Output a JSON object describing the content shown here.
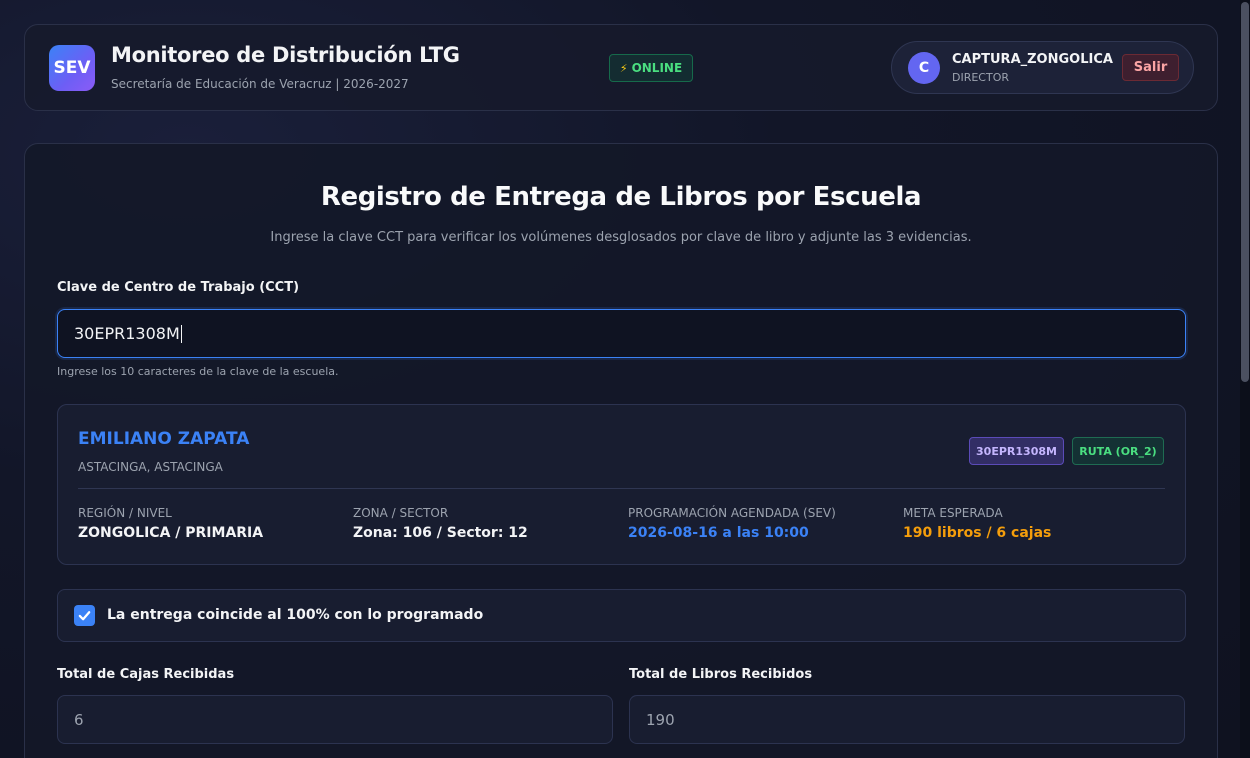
{
  "header": {
    "logo_text": "SEV",
    "title": "Monitoreo de Distribución LTG",
    "subtitle": "Secretaría de Educación de Veracruz | 2026-2027",
    "status_text": "ONLINE",
    "user": {
      "avatar_letter": "C",
      "name": "CAPTURA_ZONGOLICA",
      "role": "DIRECTOR",
      "logout_label": "Salir"
    }
  },
  "form": {
    "title": "Registro de Entrega de Libros por Escuela",
    "subtitle": "Ingrese la clave CCT para verificar los volúmenes desglosados por clave de libro y adjunte las 3 evidencias.",
    "cct_label": "Clave de Centro de Trabajo (CCT)",
    "cct_value": "30EPR1308M",
    "cct_hint": "Ingrese los 10 caracteres de la clave de la escuela."
  },
  "school": {
    "name": "EMILIANO ZAPATA",
    "location": "ASTACINGA, ASTACINGA",
    "cct_badge": "30EPR1308M",
    "route_badge": "RUTA (OR_2)",
    "region_label": "REGIÓN / NIVEL",
    "region_value": "ZONGOLICA / PRIMARIA",
    "zone_label": "ZONA / SECTOR",
    "zone_value": "Zona: 106 / Sector: 12",
    "schedule_label": "PROGRAMACIÓN AGENDADA (SEV)",
    "schedule_value": "2026-08-16 a las 10:00",
    "goal_label": "META ESPERADA",
    "goal_value": "190 libros / 6 cajas"
  },
  "confirmation": {
    "checked": true,
    "label": "La entrega coincide al 100% con lo programado"
  },
  "totals": {
    "boxes_label": "Total de Cajas Recibidas",
    "boxes_value": "6",
    "books_label": "Total de Libros Recibidos",
    "books_value": "190"
  },
  "icons": {
    "status": "lightning-bolt-icon",
    "checkbox": "checkmark-icon"
  },
  "colors": {
    "accent": "#3b82f6",
    "online": "#4ade80",
    "warning": "#f59e0b",
    "logout": "#fca5a5"
  }
}
